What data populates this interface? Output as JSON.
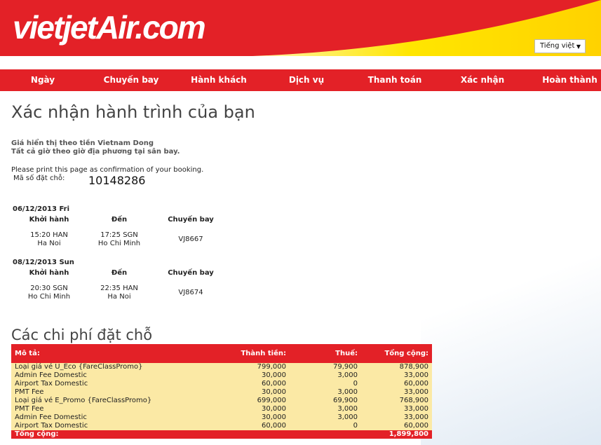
{
  "header": {
    "logo_text": "vietjetAir.com",
    "language_select": "Tiếng việt",
    "colors": {
      "brand_red": "#e32127",
      "yellow": "#ffe600"
    }
  },
  "nav": {
    "items": [
      {
        "label": "Ngày"
      },
      {
        "label": "Chuyến bay"
      },
      {
        "label": "Hành khách"
      },
      {
        "label": "Dịch vụ"
      },
      {
        "label": "Thanh toán"
      },
      {
        "label": "Xác nhận"
      },
      {
        "label": "Hoàn thành"
      }
    ]
  },
  "page": {
    "title": "Xác nhận hành trình của bạn",
    "currency_note": "Giá hiển thị theo tiền Vietnam Dong",
    "time_note": "Tất cả giờ theo giờ địa phương tại sân bay.",
    "print_note": "Please print this page as confirmation of your booking.",
    "booking_label": "Mã số đặt chỗ:",
    "booking_number": "10148286"
  },
  "itinerary": {
    "col_depart": "Khởi hành",
    "col_arrive": "Đến",
    "col_flight": "Chuyến bay",
    "flights": [
      {
        "date": "06/12/2013 Fri",
        "depart_time": "15:20 HAN",
        "depart_city": "Ha Noi",
        "arrive_time": "17:25 SGN",
        "arrive_city": "Ho Chi Minh",
        "flight_no": "VJ8667"
      },
      {
        "date": "08/12/2013 Sun",
        "depart_time": "20:30 SGN",
        "depart_city": "Ho Chi Minh",
        "arrive_time": "22:35 HAN",
        "arrive_city": "Ha Noi",
        "flight_no": "VJ8674"
      }
    ]
  },
  "costs": {
    "title": "Các chi phí đặt chỗ",
    "headers": {
      "desc": "Mô tả:",
      "amount": "Thành tiền:",
      "tax": "Thuế:",
      "total": "Tổng cộng:"
    },
    "rows": [
      {
        "desc": "Loại giá vé U_Eco {FareClassPromo}",
        "amount": "799,000",
        "tax": "79,900",
        "total": "878,900"
      },
      {
        "desc": "Admin Fee Domestic",
        "amount": "30,000",
        "tax": "3,000",
        "total": "33,000"
      },
      {
        "desc": "Airport Tax Domestic",
        "amount": "60,000",
        "tax": "0",
        "total": "60,000"
      },
      {
        "desc": "PMT Fee",
        "amount": "30,000",
        "tax": "3,000",
        "total": "33,000"
      },
      {
        "desc": "Loại giá vé E_Promo {FareClassPromo}",
        "amount": "699,000",
        "tax": "69,900",
        "total": "768,900"
      },
      {
        "desc": "PMT Fee",
        "amount": "30,000",
        "tax": "3,000",
        "total": "33,000"
      },
      {
        "desc": "Admin Fee Domestic",
        "amount": "30,000",
        "tax": "3,000",
        "total": "33,000"
      },
      {
        "desc": "Airport Tax Domestic",
        "amount": "60,000",
        "tax": "0",
        "total": "60,000"
      }
    ],
    "footer": {
      "label": "Tổng cộng:",
      "total": "1,899,800"
    },
    "colors": {
      "header_bg": "#e32127",
      "body_bg": "#fbe9a5"
    }
  }
}
